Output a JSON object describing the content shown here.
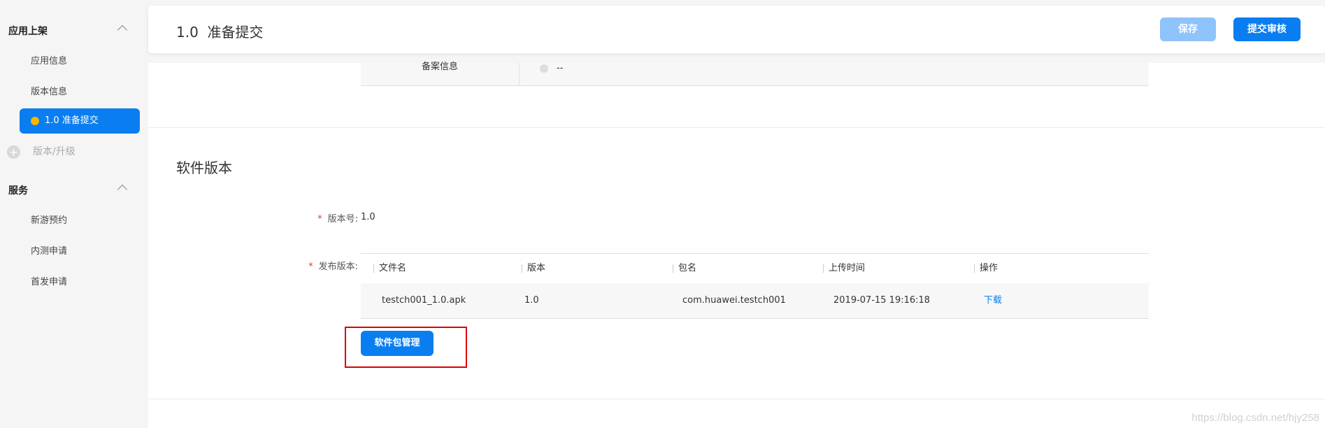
{
  "sidebar": {
    "groups": [
      {
        "title": "应用上架",
        "items": [
          {
            "label": "应用信息"
          },
          {
            "label": "版本信息"
          },
          {
            "label": "1.0 准备提交"
          }
        ],
        "add_label": "版本/升级"
      },
      {
        "title": "服务",
        "items": [
          {
            "label": "新游预约"
          },
          {
            "label": "内测申请"
          },
          {
            "label": "首发申请"
          }
        ]
      }
    ],
    "active_dot_color": "#f7b500"
  },
  "header": {
    "title": "1.0  准备提交",
    "save_label": "保存",
    "submit_label": "提交审核"
  },
  "filing": {
    "label": "备案信息",
    "value": "--"
  },
  "software_version": {
    "section_title": "软件版本",
    "version_label": "版本号:",
    "version_value": "1.0",
    "release_label": "发布版本:",
    "table": {
      "columns": [
        "文件名",
        "版本",
        "包名",
        "上传时间",
        "操作"
      ],
      "rows": [
        {
          "filename": "testch001_1.0.apk",
          "version": "1.0",
          "package": "com.huawei.testch001",
          "upload_time": "2019-07-15 19:16:18",
          "action": "下载"
        }
      ]
    },
    "manage_button_label": "软件包管理"
  },
  "watermark": "https://blog.csdn.net/hjy258",
  "colors": {
    "accent": "#0a7ef0",
    "accent_disabled": "#8fc3fb",
    "required": "#e53935",
    "highlight": "#e00000"
  }
}
